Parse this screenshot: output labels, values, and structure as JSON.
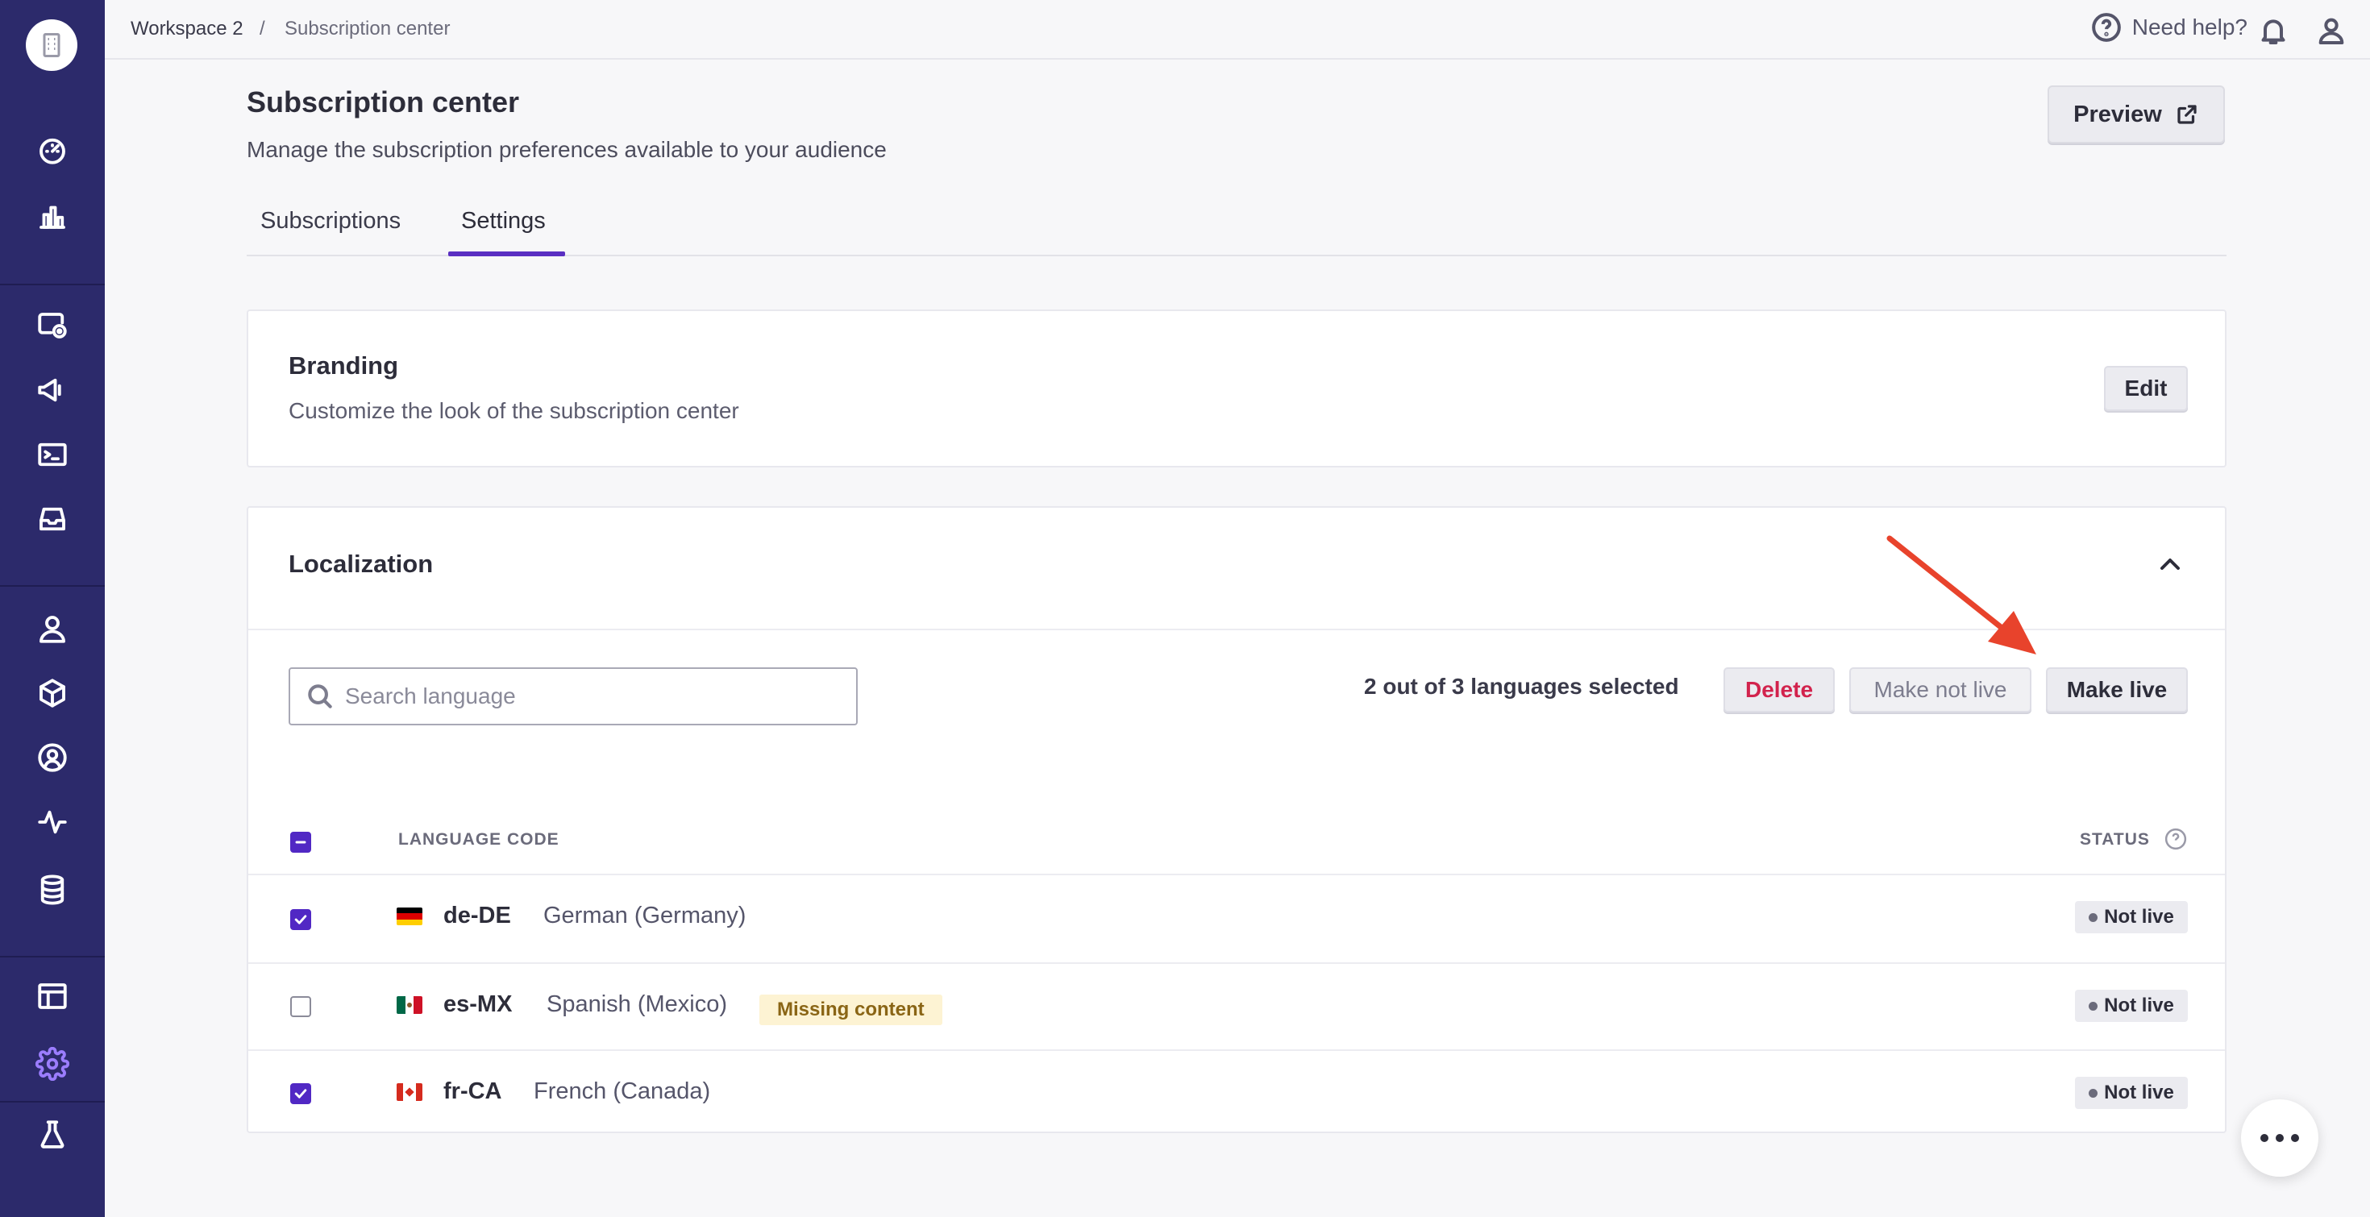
{
  "topbar": {
    "workspace": "Workspace 2",
    "separator": "/",
    "current": "Subscription center",
    "help_label": "Need help?"
  },
  "sidebar": {
    "items": [
      "dashboard-icon",
      "analytics-icon",
      "journeys-icon",
      "campaigns-icon",
      "terminal-icon",
      "inbox-icon",
      "audience-icon",
      "objects-icon",
      "accounts-icon",
      "activity-icon",
      "database-icon",
      "layout-icon",
      "settings-icon",
      "experiments-icon"
    ],
    "active": "settings-icon",
    "accent": "#9b7dff",
    "background": "#2c2a6b"
  },
  "header": {
    "title": "Subscription center",
    "subtitle": "Manage the subscription preferences available to your audience",
    "preview_label": "Preview"
  },
  "tabs": [
    {
      "label": "Subscriptions",
      "active": false
    },
    {
      "label": "Settings",
      "active": true
    }
  ],
  "branding": {
    "title": "Branding",
    "subtitle": "Customize the look of the subscription center",
    "edit_label": "Edit"
  },
  "localization": {
    "title": "Localization",
    "search_placeholder": "Search language",
    "selection_text": "2 out of 3 languages selected",
    "delete_label": "Delete",
    "make_not_live_label": "Make not live",
    "make_live_label": "Make live",
    "columns": {
      "code": "LANGUAGE CODE",
      "status": "STATUS"
    },
    "rows": [
      {
        "code": "de-DE",
        "name": "German (Germany)",
        "checked": true,
        "status": "Not live",
        "flag": "de-flag"
      },
      {
        "code": "es-MX",
        "name": "Spanish (Mexico)",
        "checked": false,
        "status": "Not live",
        "flag": "mx-flag",
        "badge": "Missing content"
      },
      {
        "code": "fr-CA",
        "name": "French (Canada)",
        "checked": true,
        "status": "Not live",
        "flag": "ca-flag"
      }
    ]
  },
  "colors": {
    "primary": "#5128c4",
    "danger": "#d2234d",
    "annotation_arrow": "#e8432c"
  }
}
